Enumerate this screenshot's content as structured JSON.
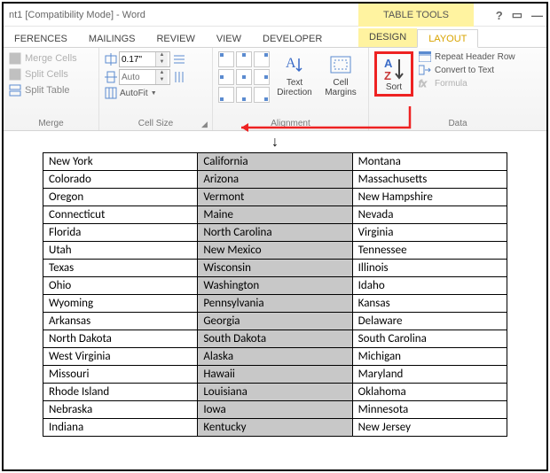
{
  "titlebar": {
    "title": "nt1 [Compatibility Mode] - Word",
    "contextual_label": "TABLE TOOLS",
    "help_icon": "?",
    "restore_icon": "▭",
    "minimize_icon": "—"
  },
  "tabs": {
    "left": [
      "FERENCES",
      "MAILINGS",
      "REVIEW",
      "VIEW",
      "DEVELOPER"
    ],
    "right": [
      "DESIGN",
      "LAYOUT"
    ],
    "active": "LAYOUT"
  },
  "ribbon": {
    "merge": {
      "group_label": "Merge",
      "merge_cells": "Merge Cells",
      "split_cells": "Split Cells",
      "split_table": "Split Table"
    },
    "cell_size": {
      "group_label": "Cell Size",
      "height_value": "0.17\"",
      "width_value": "",
      "auto_label": "Auto",
      "autofit_label": "AutoFit"
    },
    "alignment": {
      "group_label": "Alignment",
      "text_direction": "Text Direction",
      "cell_margins": "Cell Margins"
    },
    "sort": {
      "label": "Sort"
    },
    "data": {
      "group_label": "Data",
      "repeat_header": "Repeat Header Row",
      "convert_text": "Convert to Text",
      "formula": "Formula"
    }
  },
  "table": {
    "rows": [
      [
        "New York",
        "California",
        "Montana"
      ],
      [
        "Colorado",
        "Arizona",
        "Massachusetts"
      ],
      [
        "Oregon",
        "Vermont",
        "New Hampshire"
      ],
      [
        "Connecticut",
        "Maine",
        "Nevada"
      ],
      [
        "Florida",
        "North Carolina",
        "Virginia"
      ],
      [
        "Utah",
        "New Mexico",
        "Tennessee"
      ],
      [
        "Texas",
        "Wisconsin",
        "Illinois"
      ],
      [
        "Ohio",
        "Washington",
        "Idaho"
      ],
      [
        "Wyoming",
        "Pennsylvania",
        "Kansas"
      ],
      [
        "Arkansas",
        "Georgia",
        "Delaware"
      ],
      [
        "North Dakota",
        "South Dakota",
        "South Carolina"
      ],
      [
        "West Virginia",
        "Alaska",
        "Michigan"
      ],
      [
        "Missouri",
        "Hawaii",
        "Maryland"
      ],
      [
        "Rhode Island",
        "Louisiana",
        "Oklahoma"
      ],
      [
        "Nebraska",
        "Iowa",
        "Minnesota"
      ],
      [
        "Indiana",
        "Kentucky",
        "New Jersey"
      ]
    ],
    "selected_column": 1
  }
}
